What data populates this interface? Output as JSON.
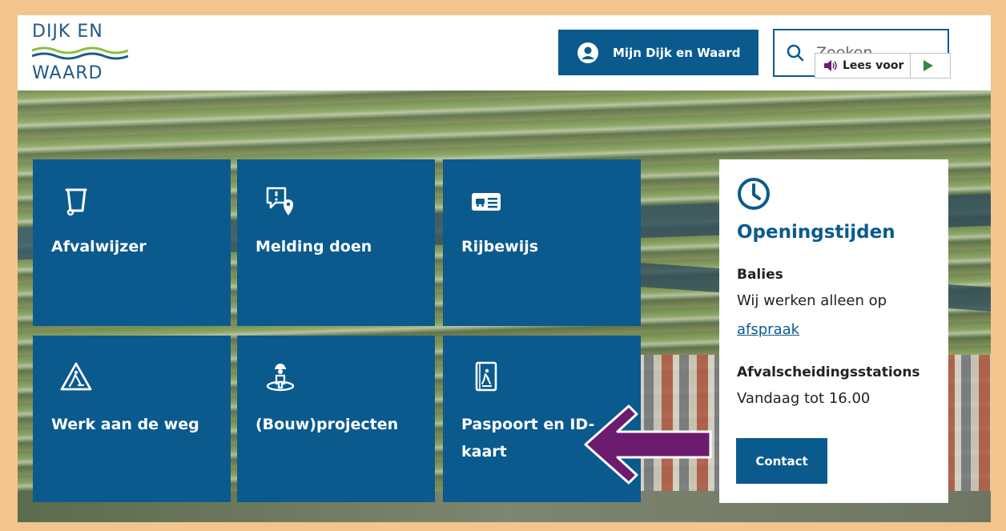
{
  "header": {
    "logo": {
      "line1": "DIJK EN",
      "line2": "WAARD",
      "colors": {
        "text": "#1f5a87",
        "wave_green": "#8cbf3f",
        "wave_blue": "#1f5a87"
      }
    },
    "account_button": {
      "label": "Mijn Dijk en Waard",
      "icon": "user-circle-icon"
    },
    "search": {
      "placeholder": "Zoeken",
      "icon": "search-icon"
    }
  },
  "read_aloud": {
    "label": "Lees voor",
    "icon": "speaker-icon",
    "play_icon": "play-icon"
  },
  "tiles": [
    {
      "label": "Afvalwijzer",
      "icon": "trash-bin-icon"
    },
    {
      "label": "Melding doen",
      "icon": "report-location-icon"
    },
    {
      "label": "Rijbewijs",
      "icon": "drivers-license-icon"
    },
    {
      "label": "Werk aan de weg",
      "icon": "roadwork-icon"
    },
    {
      "label": "(Bouw)projecten",
      "icon": "construction-worker-icon"
    },
    {
      "label": "Paspoort en ID-kaart",
      "icon": "passport-icon"
    }
  ],
  "openingstijden": {
    "icon": "clock-icon",
    "title": "Openingstijden",
    "balies_heading": "Balies",
    "balies_text": "Wij werken alleen op",
    "balies_link": "afspraak",
    "afval_heading": "Afvalscheidingsstations",
    "afval_text": "Vandaag tot 16.00",
    "contact_label": "Contact"
  },
  "colors": {
    "primary": "#0a5a8e",
    "frame": "#f2c58e",
    "arrow": "#6b1c6e"
  }
}
